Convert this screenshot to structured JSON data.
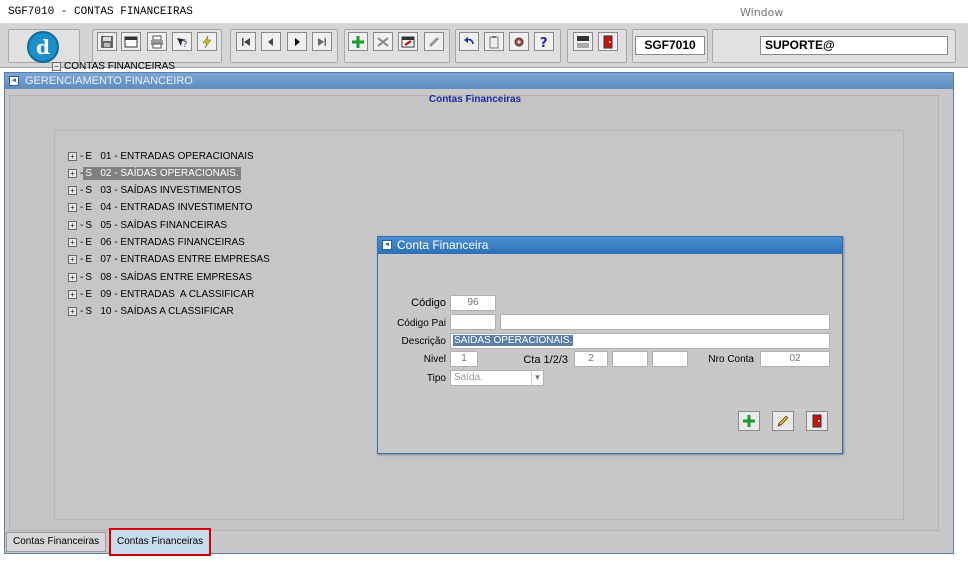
{
  "window": {
    "title": "SGF7010 - CONTAS FINANCEIRAS",
    "menu_window": "Window"
  },
  "toolbar": {
    "form_code": "SGF7010",
    "user": "SUPORTE@"
  },
  "mainwin": {
    "title": "GERENCIAMENTO FINANCEIRO",
    "panel_caption": "Contas Financeiras"
  },
  "tree": {
    "root": "CONTAS FINANCEIRAS",
    "items": [
      {
        "label": "E   01 - ENTRADAS OPERACIONAIS"
      },
      {
        "label": "S   02 - SAÍDAS OPERACIONAIS."
      },
      {
        "label": "S   03 - SAÍDAS INVESTIMENTOS"
      },
      {
        "label": "E   04 - ENTRADAS INVESTIMENTO"
      },
      {
        "label": "S   05 - SAÍDAS FINANCEIRAS"
      },
      {
        "label": "E   06 - ENTRADAS FINANCEIRAS"
      },
      {
        "label": "E   07 - ENTRADAS ENTRE EMPRESAS"
      },
      {
        "label": "S   08 - SAÍDAS ENTRE EMPRESAS"
      },
      {
        "label": "E   09 - ENTRADAS  A CLASSIFICAR"
      },
      {
        "label": "S   10 - SAÍDAS A CLASSIFICAR"
      }
    ],
    "selected_index": 1
  },
  "dialog": {
    "title": "Conta Financeira",
    "codigo_label": "Código",
    "codigo_value": "96",
    "codigo_pai_label": "Código Pai",
    "codigo_pai_value": "",
    "codigo_pai_desc": "",
    "descricao_label": "Descrição",
    "descricao_value": "SAÍDAS OPERACIONAIS.",
    "nivel_label": "Nivel",
    "nivel_value": "1",
    "cta_label": "Cta 1/2/3",
    "cta1_value": "2",
    "cta2_value": "",
    "cta3_value": "",
    "nro_conta_label": "Nro Conta",
    "nro_conta_value": "02",
    "tipo_label": "Tipo",
    "tipo_value": "Saída."
  },
  "tabs": [
    {
      "label": "Contas Financeiras"
    },
    {
      "label": "Contas Financeiras"
    }
  ],
  "colors": {
    "accent_blue": "#2a6fb8",
    "highlight_red": "#d00000"
  }
}
